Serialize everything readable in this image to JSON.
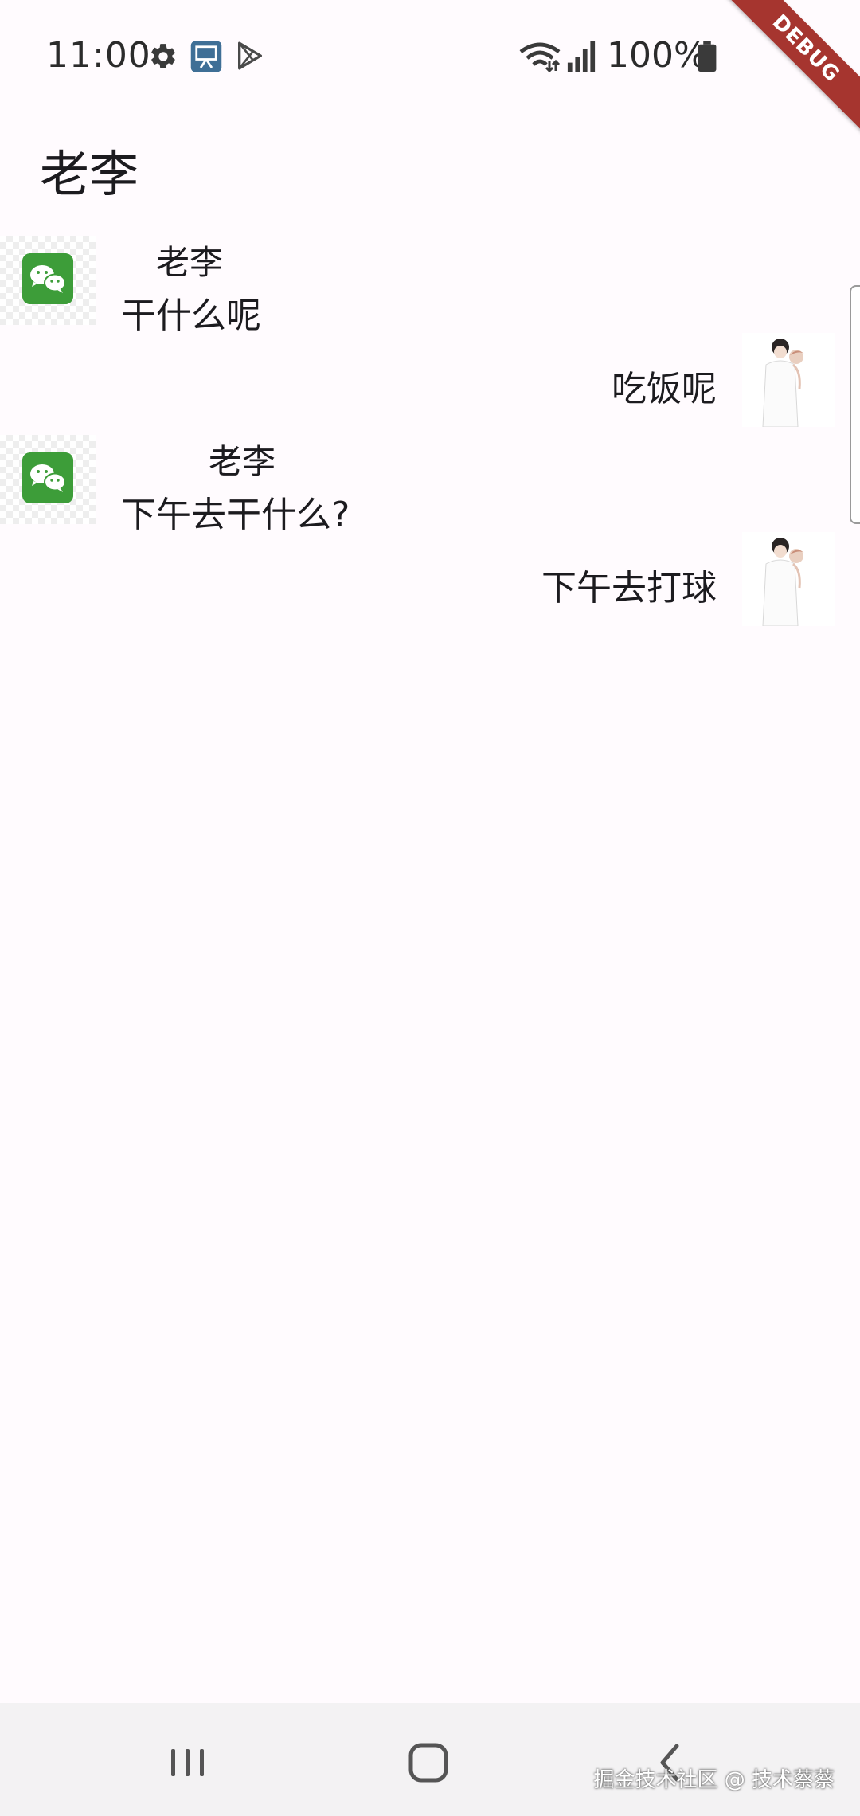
{
  "status_bar": {
    "time": "11:00",
    "battery_percent": "100%",
    "icons": [
      "gear-icon",
      "slideshow-icon",
      "play-store-icon",
      "wifi-icon",
      "signal-icon",
      "battery-icon"
    ]
  },
  "debug_banner": "DEBUG",
  "app_bar": {
    "title": "老李"
  },
  "messages": [
    {
      "side": "left",
      "sender": "老李",
      "text": "干什么呢",
      "avatar": "wechat-icon"
    },
    {
      "side": "right",
      "text": "吃饭呢",
      "avatar": "user-photo"
    },
    {
      "side": "left",
      "sender": "老李",
      "text": "下午去干什么?",
      "avatar": "wechat-icon"
    },
    {
      "side": "right",
      "text": "下午去打球",
      "avatar": "user-photo"
    }
  ],
  "nav_bar": {
    "buttons": [
      "recents-icon",
      "home-icon",
      "back-icon"
    ],
    "watermark": "掘金技术社区 @ 技术蔡蔡"
  },
  "colors": {
    "background": "#fffbfe",
    "debug_ribbon": "#a6352f",
    "wechat_green": "#3d9d39",
    "nav_bar": "#f3f2f3"
  }
}
